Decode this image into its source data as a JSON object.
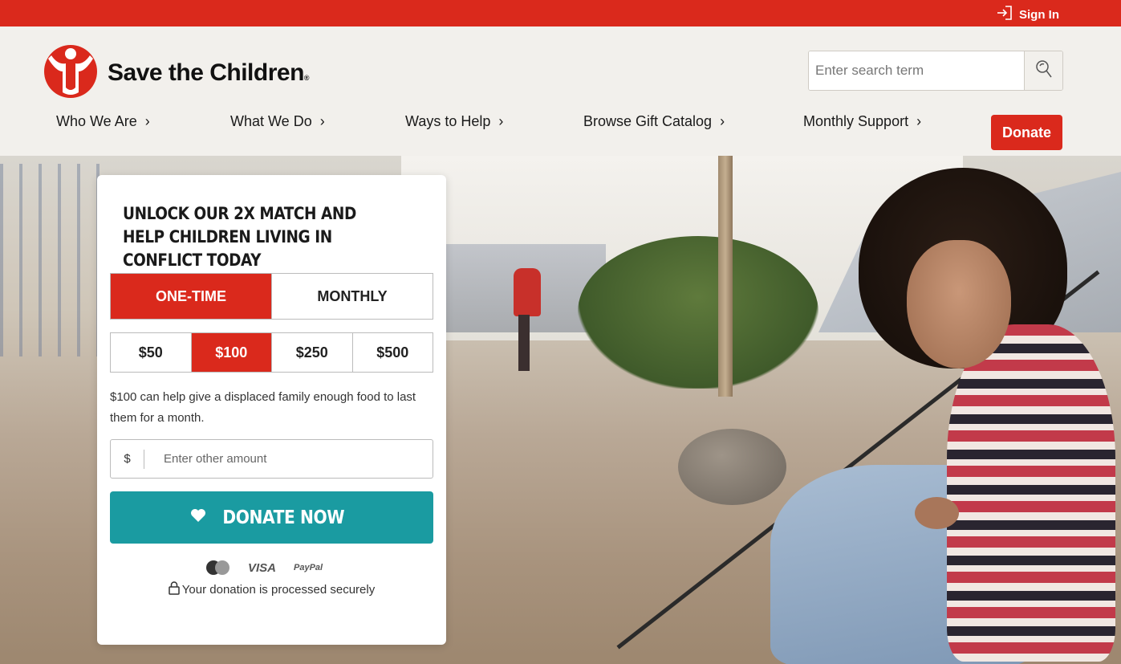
{
  "topbar": {
    "signin_label": "Sign In"
  },
  "header": {
    "logo_text": "Save the Children",
    "logo_mark": "®",
    "search_placeholder": "Enter search term"
  },
  "nav": {
    "items": [
      {
        "label": "Who We Are",
        "chevron": "›"
      },
      {
        "label": "What We Do",
        "chevron": "›"
      },
      {
        "label": "Ways to Help",
        "chevron": "›"
      },
      {
        "label": "Browse Gift Catalog",
        "chevron": "›"
      },
      {
        "label": "Monthly Support",
        "chevron": "›"
      }
    ],
    "donate_label": "Donate"
  },
  "donation": {
    "heading": "UNLOCK OUR 2X MATCH AND HELP CHILDREN LIVING IN CONFLICT TODAY",
    "frequency": {
      "one_time": "ONE-TIME",
      "monthly": "MONTHLY",
      "selected": "one_time"
    },
    "amounts": [
      "$50",
      "$100",
      "$250",
      "$500"
    ],
    "selected_amount": "$100",
    "impact_text": "$100 can help give a displaced family enough food to last them for a month.",
    "currency_symbol": "$",
    "other_placeholder": "Enter other amount",
    "donate_now_label": "DONATE NOW",
    "payment_methods": {
      "visa": "VISA",
      "paypal": "PayPal"
    },
    "secure_text": "Your donation is processed securely"
  },
  "colors": {
    "brand_red": "#da291c",
    "teal": "#1a9ba1",
    "header_bg": "#f2f0ec"
  }
}
